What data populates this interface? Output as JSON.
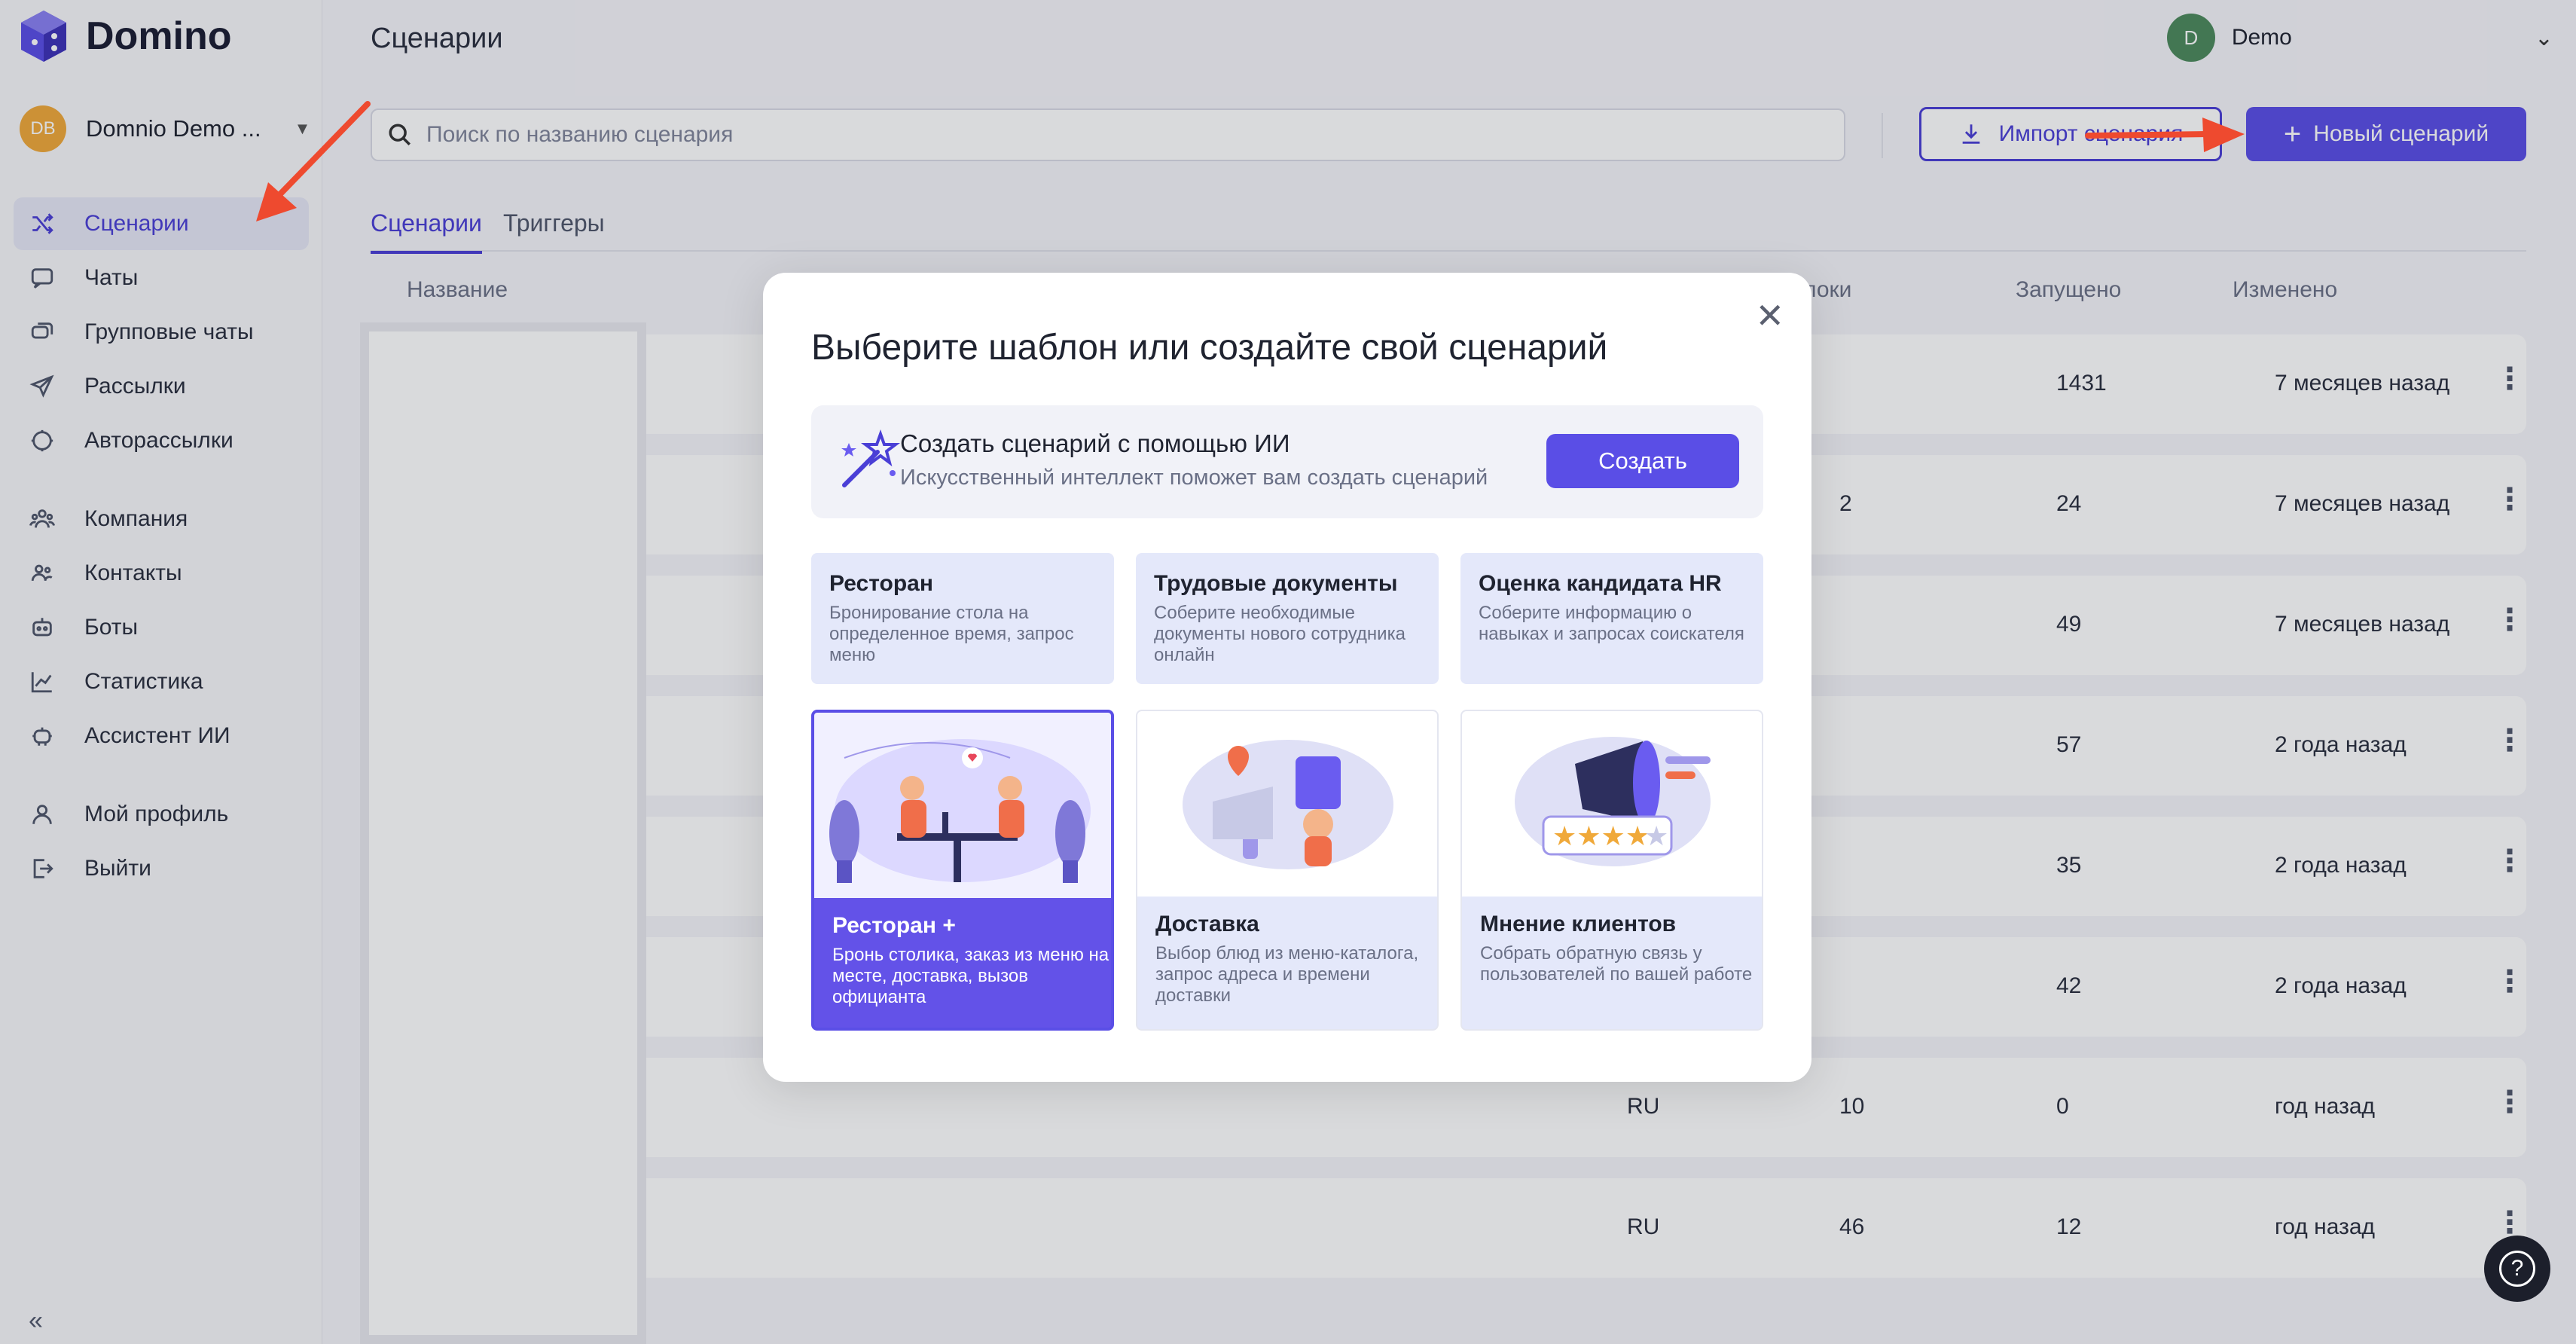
{
  "brand": {
    "name": "Domino"
  },
  "org": {
    "initials": "DB",
    "name": "Domnio Demo ..."
  },
  "sidebar": {
    "items": [
      {
        "label": "Сценарии",
        "icon": "shuffle-icon"
      },
      {
        "label": "Чаты",
        "icon": "chat-icon"
      },
      {
        "label": "Групповые чаты",
        "icon": "group-chat-icon"
      },
      {
        "label": "Рассылки",
        "icon": "send-icon"
      },
      {
        "label": "Авторассылки",
        "icon": "auto-send-icon"
      },
      {
        "label": "Компания",
        "icon": "company-icon"
      },
      {
        "label": "Контакты",
        "icon": "contacts-icon"
      },
      {
        "label": "Боты",
        "icon": "bot-icon"
      },
      {
        "label": "Статистика",
        "icon": "chart-icon"
      },
      {
        "label": "Ассистент ИИ",
        "icon": "robot-icon"
      },
      {
        "label": "Мой профиль",
        "icon": "user-icon"
      },
      {
        "label": "Выйти",
        "icon": "logout-icon"
      }
    ],
    "collapse_label": "«"
  },
  "header": {
    "title": "Сценарии",
    "user_initial": "D",
    "user_name": "Demo"
  },
  "toolbar": {
    "search_placeholder": "Поиск по названию сценария",
    "import_label": "Импорт сценария",
    "new_label": "Новый сценарий"
  },
  "tabs": [
    {
      "label": "Сценарии"
    },
    {
      "label": "Триггеры"
    }
  ],
  "table": {
    "headers": {
      "name": "Название",
      "blocks": "локи",
      "launched": "Запущено",
      "changed": "Изменено"
    },
    "rows": [
      {
        "lang": "",
        "blocks": "",
        "launched": "1431",
        "changed": "7 месяцев назад"
      },
      {
        "lang": "",
        "blocks": "2",
        "launched": "24",
        "changed": "7 месяцев назад"
      },
      {
        "lang": "",
        "blocks": "",
        "launched": "49",
        "changed": "7 месяцев назад"
      },
      {
        "lang": "",
        "blocks": "",
        "launched": "57",
        "changed": "2 года назад"
      },
      {
        "lang": "",
        "blocks": "",
        "launched": "35",
        "changed": "2 года назад"
      },
      {
        "lang": "",
        "blocks": "",
        "launched": "42",
        "changed": "2 года назад"
      },
      {
        "lang": "RU",
        "blocks": "10",
        "launched": "0",
        "changed": "год назад"
      },
      {
        "lang": "RU",
        "blocks": "46",
        "launched": "12",
        "changed": "год назад"
      }
    ]
  },
  "modal": {
    "title": "Выберите шаблон или создайте свой сценарий",
    "ai": {
      "title": "Создать сценарий с помощью ИИ",
      "desc": "Искусственный интеллект поможет вам создать сценарий",
      "button": "Создать"
    },
    "templates": [
      {
        "name": "Ресторан",
        "desc": "Бронирование стола на определенное время, запрос меню"
      },
      {
        "name": "Трудовые документы",
        "desc": "Соберите необходимые документы нового сотрудника онлайн"
      },
      {
        "name": "Оценка кандидата HR",
        "desc": "Соберите информацию о навыках и запросах соискателя"
      },
      {
        "name": "Ресторан +",
        "desc": "Бронь столика, заказ из меню на месте, доставка, вызов официанта"
      },
      {
        "name": "Доставка",
        "desc": "Выбор блюд из меню-каталога, запрос адреса и времени доставки"
      },
      {
        "name": "Мнение клиентов",
        "desc": "Собрать обратную связь у пользователей по вашей работе"
      }
    ]
  },
  "colors": {
    "accent": "#5a4ee6",
    "annotation": "#ee4a2f"
  }
}
